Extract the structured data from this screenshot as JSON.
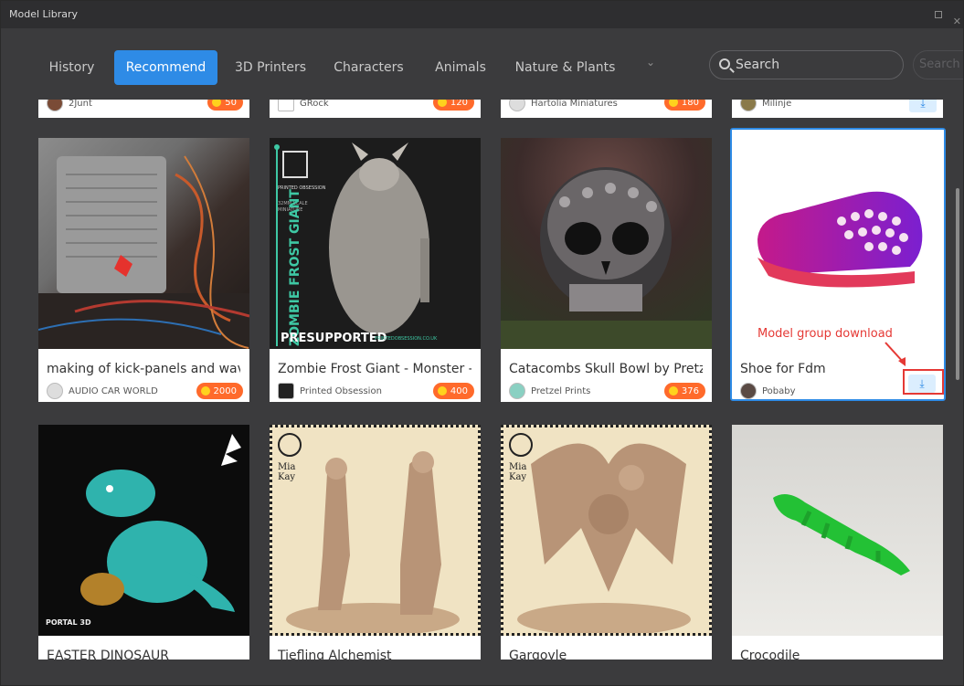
{
  "window": {
    "title": "Model Library"
  },
  "nav": {
    "tabs": [
      {
        "label": "History",
        "active": false
      },
      {
        "label": "Recommend",
        "active": true
      },
      {
        "label": "3D Printers",
        "active": false
      },
      {
        "label": "Characters",
        "active": false
      },
      {
        "label": "Animals",
        "active": false
      },
      {
        "label": "Nature & Plants",
        "active": false
      }
    ],
    "search_placeholder": "Search",
    "search_button": "Search"
  },
  "top_row": [
    {
      "author": "2Junt",
      "points": "50"
    },
    {
      "author": "GRock",
      "points": "120"
    },
    {
      "author": "Hartolia Miniatures",
      "points": "180"
    },
    {
      "author": "Milinje",
      "points": ""
    }
  ],
  "cards": [
    {
      "title": "making of kick-panels and wave…",
      "author": "AUDIO CAR WORLD",
      "points": "2000"
    },
    {
      "title": "Zombie Frost Giant - Monster - P…",
      "author": "Printed Obsession",
      "points": "400"
    },
    {
      "title": "Catacombs Skull Bowl by Pretzel …",
      "author": "Pretzel Prints",
      "points": "376"
    },
    {
      "title": "Shoe for Fdm",
      "author": "Pobaby",
      "points": ""
    }
  ],
  "bottom_row": [
    {
      "title": "EASTER DINOSAUR"
    },
    {
      "title": "Tiefling Alchemist"
    },
    {
      "title": "Gargoyle"
    },
    {
      "title": "Crocodile"
    }
  ],
  "thumb_text": {
    "zombie_side": "ZOMBIE FROST GIANT",
    "zombie_presupported": "PRESUPPORTED",
    "zombie_site": "PRINTEDOBSESSION.CO.UK",
    "zombie_brand": "PRINTED OBSESSION",
    "zombie_scale": "32MM SCALE MINIATURE",
    "mia_kay_1": "Mia Kay",
    "mia_kay_2": "Mia Kay",
    "portal_logo": "PORTAL 3D"
  },
  "annotation": {
    "text": "Model group download"
  },
  "colors": {
    "accent": "#2e8be6",
    "badge": "#ff6a2b",
    "annotation": "#e53935",
    "background": "#3b3b3d"
  }
}
